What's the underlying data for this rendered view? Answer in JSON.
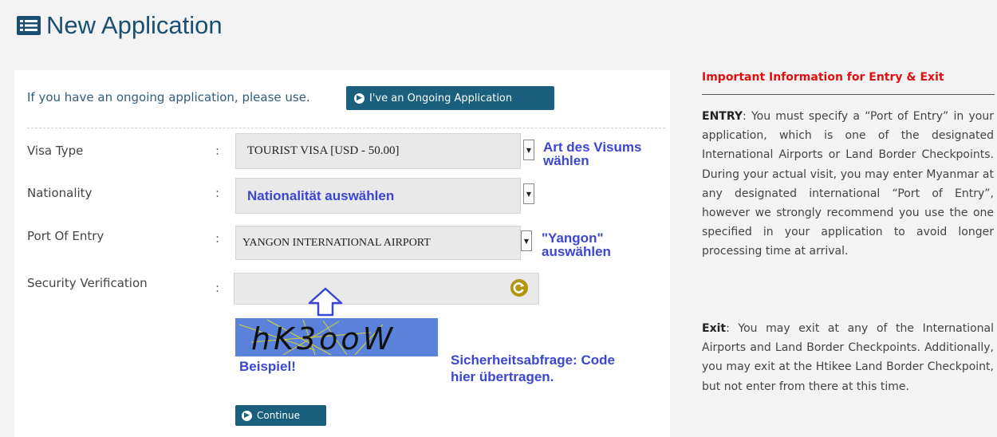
{
  "header": {
    "title": "New Application",
    "icon": "list-alt-icon"
  },
  "ongoing": {
    "text": "If you have an ongoing application, please use.",
    "button_label": "I've an Ongoing Application"
  },
  "form": {
    "visa_type": {
      "label": "Visa Type",
      "colon": ":",
      "value": "TOURIST VISA [USD - 50.00]",
      "annotation": "Art des Visums wählen"
    },
    "nationality": {
      "label": "Nationality",
      "colon": ":",
      "value": "Nationalität auswählen"
    },
    "port_of_entry": {
      "label": "Port Of Entry",
      "colon": ":",
      "value": "YANGON INTERNATIONAL AIRPORT",
      "annotation": "\"Yangon\" auswählen"
    },
    "security": {
      "label": "Security Verification",
      "colon": ":",
      "value": "",
      "captcha_text": "hK3ooW",
      "example_label": "Beispiel!",
      "annotation": "Sicherheitsabfrage: Code hier übertragen."
    },
    "continue_label": "Continue"
  },
  "info": {
    "title": "Important Information for Entry & Exit",
    "entry_heading": "ENTRY",
    "entry_text": ": You must specify a “Port of Entry” in your application, which is one of the designated International Airports or Land Border Checkpoints. During your actual visit, you may enter Myanmar at any designated international “Port of Entry”, however we strongly recommend you use the one specified in your application to avoid longer processing time at arrival.",
    "exit_heading": "Exit",
    "exit_text": ": You may exit at any of the International Airports and Land Border Checkpoints. Additionally, you may exit at the Htikee Land Border Checkpoint, but not enter from there at this time."
  },
  "colors": {
    "accent": "#1b5f7e",
    "title": "#1b4f72",
    "annotation": "#3b46d4",
    "warning": "#e01010",
    "refresh": "#b2960e",
    "captcha_bg": "#5a82db"
  }
}
